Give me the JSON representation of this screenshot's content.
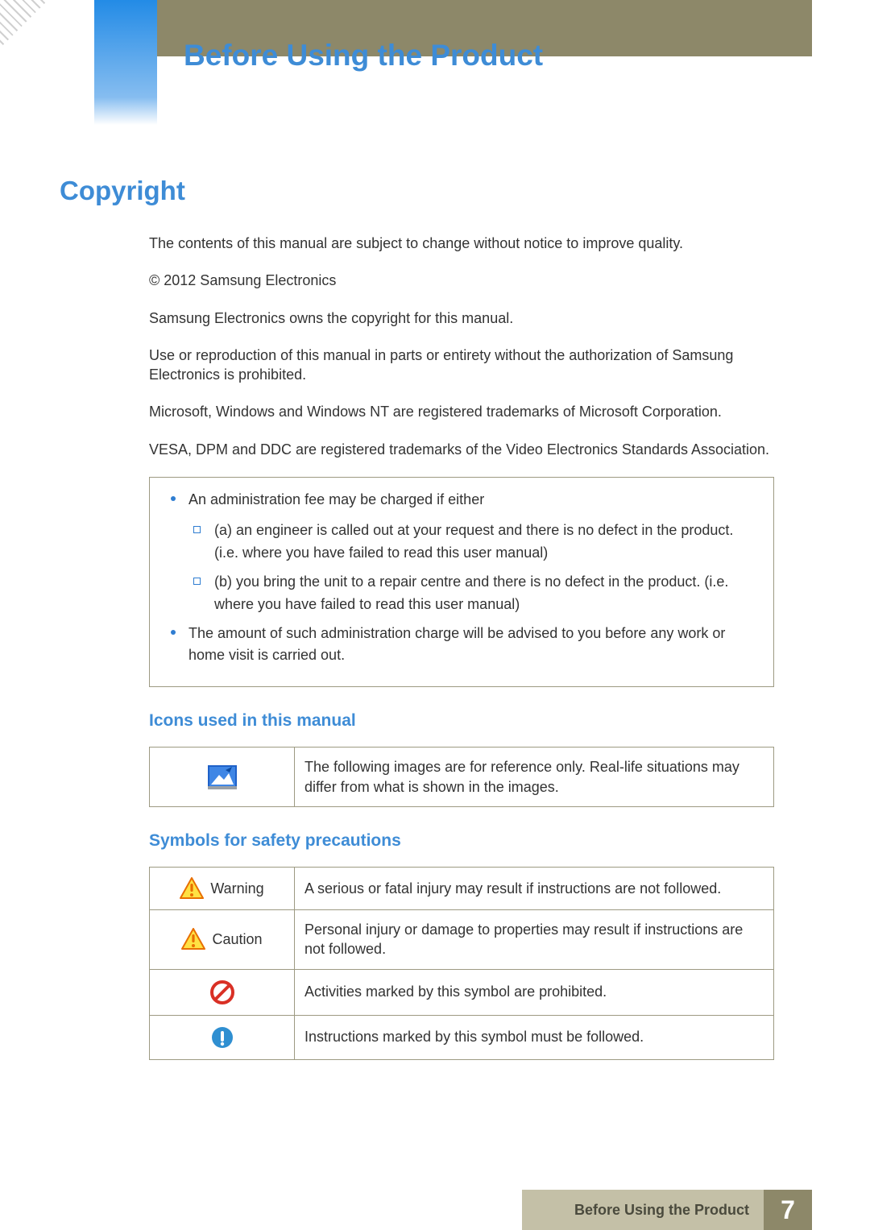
{
  "header": {
    "chapter_title": "Before Using the Product"
  },
  "section": {
    "title": "Copyright"
  },
  "paragraphs": {
    "p1": "The contents of this manual are subject to change without notice to improve quality.",
    "p2": "© 2012 Samsung Electronics",
    "p3": "Samsung Electronics owns the copyright for this manual.",
    "p4": "Use or reproduction of this manual in parts or entirety without the authorization of Samsung Electronics is prohibited.",
    "p5": "Microsoft, Windows and Windows NT are registered trademarks of Microsoft Corporation.",
    "p6": "VESA, DPM and DDC are registered trademarks of the Video Electronics Standards Association."
  },
  "note": {
    "l1a": "An administration fee may be charged if either",
    "l2a": "(a) an engineer is called out at your request and there is no defect in the product. (i.e. where you have failed to read this user manual)",
    "l2b": "(b) you bring the unit to a repair centre and there is no defect in the product. (i.e. where you have failed to read this user manual)",
    "l1b": "The amount of such administration charge will be advised to you before any work or home visit is carried out."
  },
  "sub1": {
    "title": "Icons used in this manual"
  },
  "icons_table": {
    "row1_label": "",
    "row1_desc": "The following images are for reference only. Real-life situations may differ from what is shown in the images."
  },
  "sub2": {
    "title": "Symbols for safety precautions"
  },
  "safety_table": {
    "rows": [
      {
        "label": "Warning",
        "desc": "A serious or fatal injury may result if instructions are not followed."
      },
      {
        "label": "Caution",
        "desc": "Personal injury or damage to properties may result if instructions are not followed."
      },
      {
        "label": "",
        "desc": "Activities marked by this symbol are prohibited."
      },
      {
        "label": "",
        "desc": "Instructions marked by this symbol must be followed."
      }
    ]
  },
  "footer": {
    "chapter": "Before Using the Product",
    "page": "7"
  }
}
